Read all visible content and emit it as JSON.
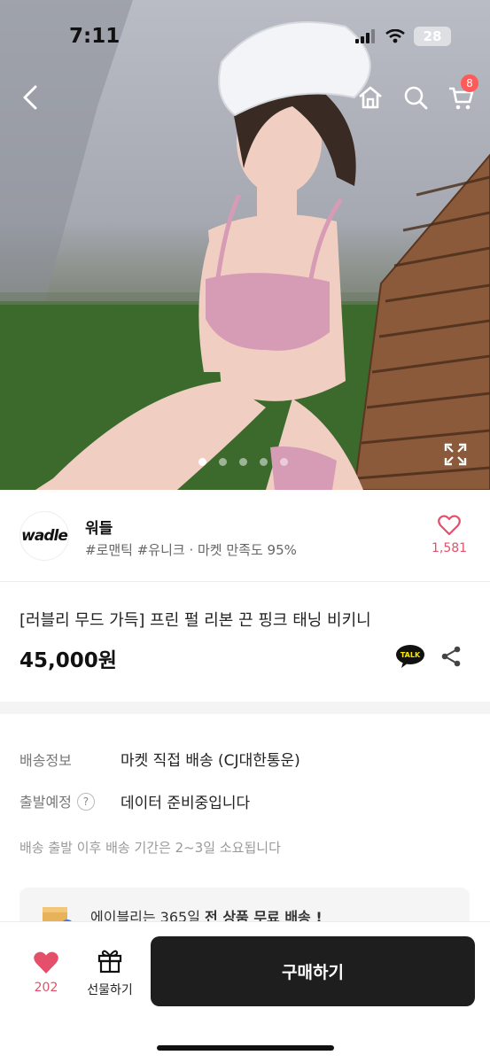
{
  "status_bar": {
    "time": "7:11",
    "battery": "28"
  },
  "nav": {
    "back_icon": "chevron-left-icon",
    "home_icon": "home-icon",
    "search_icon": "search-icon",
    "cart_icon": "cart-icon",
    "cart_badge": "8"
  },
  "gallery": {
    "image_count": 5,
    "active_index": 0,
    "expand_icon": "expand-icon"
  },
  "seller": {
    "logo_text": "wadle",
    "name": "워들",
    "meta": "#로맨틱 #유니크 · 마켓 만족도 95%",
    "like_count": "1,581"
  },
  "product": {
    "title": "[러블리 무드 가득] 프린 펄 리본 끈 핑크 태닝 비키니",
    "price": "45,000원",
    "talk_label": "TALK"
  },
  "shipping": {
    "delivery_label": "배송정보",
    "delivery_value": "마켓 직접 배송 (CJ대한통운)",
    "departure_label": "출발예정",
    "departure_help": "?",
    "departure_value": "데이터 준비중입니다",
    "note": "배송 출발 이후 배송 기간은 2~3일 소요됩니다"
  },
  "promo": {
    "text_prefix": "에이블리는 365일 ",
    "text_bold": "전 상품 무료 배송 !"
  },
  "bottom_bar": {
    "like_count": "202",
    "gift_label": "선물하기",
    "buy_label": "구매하기"
  },
  "colors": {
    "accent_pink": "#e4506a",
    "buy_button": "#1e1e1e",
    "badge": "#ff5a5a"
  }
}
